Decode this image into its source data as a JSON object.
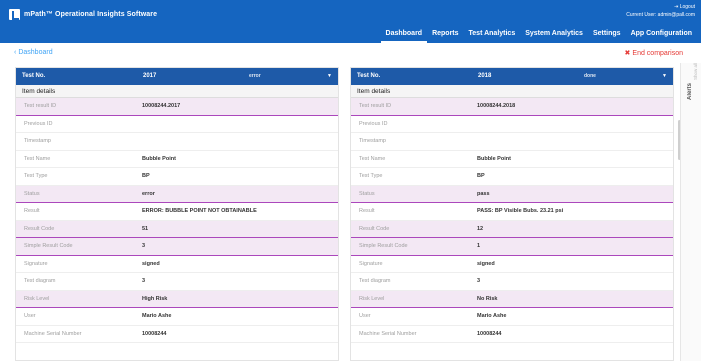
{
  "app": {
    "title": "mPath™ Operational Insights Software",
    "logout": "⇥ Logout",
    "current_user": "Current User: admin@pall.com"
  },
  "nav": [
    {
      "label": "Dashboard",
      "active": true
    },
    {
      "label": "Reports",
      "active": false
    },
    {
      "label": "Test Analytics",
      "active": false
    },
    {
      "label": "System Analytics",
      "active": false
    },
    {
      "label": "Settings",
      "active": false
    },
    {
      "label": "App Configuration",
      "active": false
    }
  ],
  "subbar": {
    "back_label": "Dashboard",
    "end_comparison": "End comparison"
  },
  "panels": [
    {
      "header_label": "Test No.",
      "header_number": "2017",
      "header_state": "error",
      "section": "Item details",
      "rows": [
        {
          "k": "Test result ID",
          "v": "10008244.2017",
          "hl": true
        },
        {
          "k": "Previous ID",
          "v": "",
          "hl": false
        },
        {
          "k": "Timestamp",
          "v": "",
          "hl": false
        },
        {
          "k": "Test Name",
          "v": "Bubble Point",
          "hl": false
        },
        {
          "k": "Test Type",
          "v": "BP",
          "hl": false
        },
        {
          "k": "Status",
          "v": "error",
          "hl": true
        },
        {
          "k": "Result",
          "v": "ERROR: BUBBLE POINT NOT OBTAINABLE",
          "hl": false
        },
        {
          "k": "Result Code",
          "v": "51",
          "hl": true
        },
        {
          "k": "Simple Result Code",
          "v": "3",
          "hl": true
        },
        {
          "k": "Signature",
          "v": "signed",
          "hl": false
        },
        {
          "k": "Test diagram",
          "v": "3",
          "hl": false
        },
        {
          "k": "Risk Level",
          "v": "High Risk",
          "hl": true
        },
        {
          "k": "User",
          "v": "Mario Ashe",
          "hl": false
        },
        {
          "k": "Machine Serial Number",
          "v": "10008244",
          "hl": false
        }
      ]
    },
    {
      "header_label": "Test No.",
      "header_number": "2018",
      "header_state": "done",
      "section": "Item details",
      "rows": [
        {
          "k": "Test result ID",
          "v": "10008244.2018",
          "hl": true
        },
        {
          "k": "Previous ID",
          "v": "",
          "hl": false
        },
        {
          "k": "Timestamp",
          "v": "",
          "hl": false
        },
        {
          "k": "Test Name",
          "v": "Bubble Point",
          "hl": false
        },
        {
          "k": "Test Type",
          "v": "BP",
          "hl": false
        },
        {
          "k": "Status",
          "v": "pass",
          "hl": true
        },
        {
          "k": "Result",
          "v": "PASS: BP Visible Bubs. 23.21 psi",
          "hl": false
        },
        {
          "k": "Result Code",
          "v": "12",
          "hl": true
        },
        {
          "k": "Simple Result Code",
          "v": "1",
          "hl": true
        },
        {
          "k": "Signature",
          "v": "signed",
          "hl": false
        },
        {
          "k": "Test diagram",
          "v": "3",
          "hl": false
        },
        {
          "k": "Risk Level",
          "v": "No Risk",
          "hl": true
        },
        {
          "k": "User",
          "v": "Mario Ashe",
          "hl": false
        },
        {
          "k": "Machine Serial Number",
          "v": "10008244",
          "hl": false
        }
      ]
    }
  ],
  "rail": {
    "alerts": "Alerts",
    "other": "Show all"
  }
}
